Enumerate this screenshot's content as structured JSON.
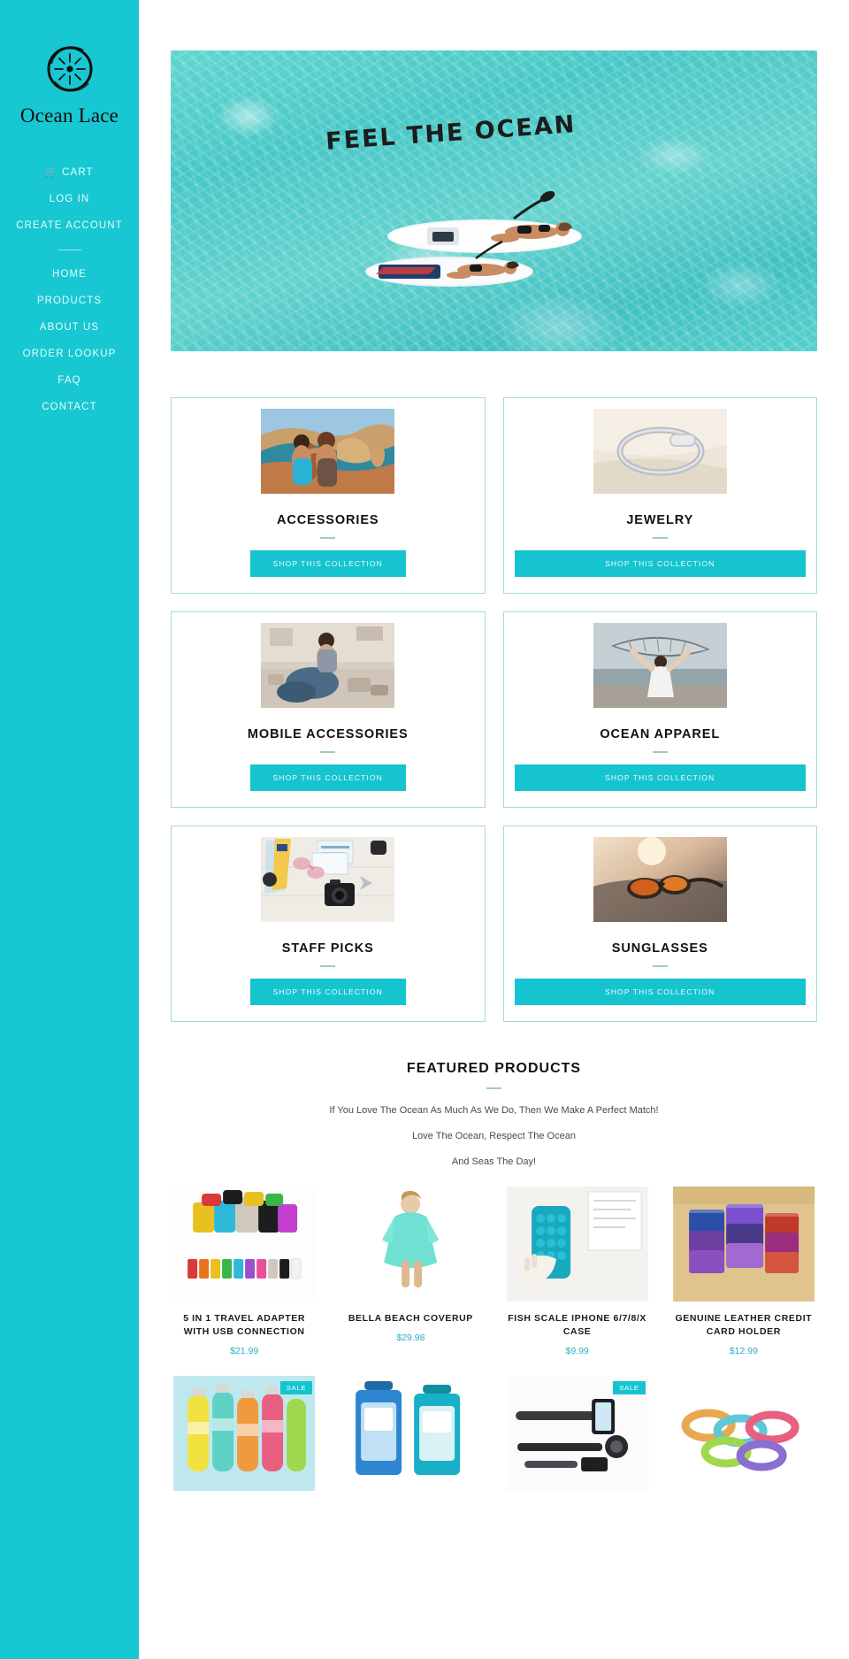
{
  "brand": {
    "name": "Ocean Lace",
    "logo_icon": "compass-sun-icon",
    "accent_color": "#17c7d2",
    "sidebar_color": "#17c7d2"
  },
  "sidebar": {
    "account_links": [
      {
        "label": "CART",
        "icon": "shopping-cart-icon",
        "name": "cart"
      },
      {
        "label": "LOG IN",
        "icon": "",
        "name": "log-in"
      },
      {
        "label": "CREATE ACCOUNT",
        "icon": "",
        "name": "create-account"
      }
    ],
    "nav_links": [
      {
        "label": "HOME",
        "name": "home"
      },
      {
        "label": "PRODUCTS",
        "name": "products"
      },
      {
        "label": "ABOUT US",
        "name": "about-us"
      },
      {
        "label": "ORDER LOOKUP",
        "name": "order-lookup"
      },
      {
        "label": "FAQ",
        "name": "faq"
      },
      {
        "label": "CONTACT",
        "name": "contact"
      }
    ]
  },
  "hero": {
    "headline": "FEEL THE OCEAN",
    "alt": "Two women on paddleboards in clear turquoise ocean water"
  },
  "collections": {
    "button_label": "SHOP THIS COLLECTION",
    "items": [
      {
        "title": "ACCESSORIES",
        "image": "two-hikers-coastal-cliff"
      },
      {
        "title": "JEWELRY",
        "image": "silver-snake-chain-bracelet"
      },
      {
        "title": "MOBILE ACCESSORIES",
        "image": "messy-room-gadgets"
      },
      {
        "title": "OCEAN APPAREL",
        "image": "woman-holding-fish-scarf-at-pier"
      },
      {
        "title": "STAFF PICKS",
        "image": "travel-flatlay-map-camera-sunglasses"
      },
      {
        "title": "SUNGLASSES",
        "image": "sunglasses-on-beach-at-sunset"
      }
    ]
  },
  "featured": {
    "heading": "FEATURED PRODUCTS",
    "lines": [
      "If You Love The Ocean As Much As We Do, Then We Make A Perfect Match!",
      "Love The Ocean, Respect The Ocean",
      "And Seas The Day!"
    ],
    "products": [
      {
        "name": "5 IN 1 TRAVEL ADAPTER WITH USB CONNECTION",
        "price": "$21.99",
        "badge": "",
        "image": "colorful-travel-adapters"
      },
      {
        "name": "BELLA BEACH COVERUP",
        "price": "$29.98",
        "badge": "",
        "image": "woman-in-turquoise-beach-coverup"
      },
      {
        "name": "FISH SCALE IPHONE 6/7/8/X CASE",
        "price": "$9.99",
        "badge": "",
        "image": "teal-fish-scale-phone-case"
      },
      {
        "name": "GENUINE LEATHER CREDIT CARD HOLDER",
        "price": "$12.99",
        "badge": "",
        "image": "stacked-leather-card-holders"
      },
      {
        "name": "",
        "price": "",
        "badge": "SALE",
        "image": "colorful-water-bottles"
      },
      {
        "name": "",
        "price": "",
        "badge": "",
        "image": "waterproof-phone-pouches"
      },
      {
        "name": "",
        "price": "",
        "badge": "SALE",
        "image": "selfie-stick-with-phone"
      },
      {
        "name": "",
        "price": "",
        "badge": "",
        "image": "colorful-wristbands"
      }
    ]
  }
}
